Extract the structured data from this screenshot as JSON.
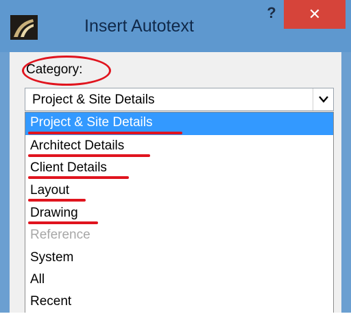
{
  "window": {
    "title": "Insert Autotext",
    "help_label": "?",
    "close_label": "✕",
    "icon": "archicad-logo-icon"
  },
  "category": {
    "label": "Category:",
    "selected_value": "Project & Site Details",
    "options": [
      {
        "label": "Project & Site Details",
        "state": "selected"
      },
      {
        "label": "Architect Details",
        "state": "normal"
      },
      {
        "label": "Client Details",
        "state": "normal"
      },
      {
        "label": "Layout",
        "state": "normal"
      },
      {
        "label": "Drawing",
        "state": "normal"
      },
      {
        "label": "Reference",
        "state": "disabled"
      },
      {
        "label": "System",
        "state": "normal"
      },
      {
        "label": "All",
        "state": "normal"
      },
      {
        "label": "Recent",
        "state": "normal"
      }
    ]
  },
  "colors": {
    "title_bar": "#5e98cf",
    "close_button": "#d6443a",
    "selection": "#3399ff",
    "annotation": "#e0141e"
  }
}
